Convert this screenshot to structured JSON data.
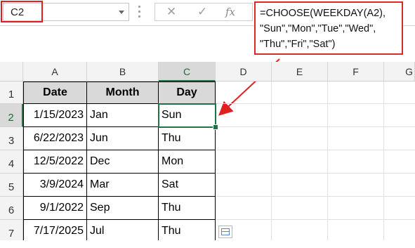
{
  "name_box": {
    "value": "C2"
  },
  "formula_bar": {
    "lines": [
      "=CHOOSE(WEEKDAY(A2),",
      "\"Sun\",\"Mon\",\"Tue\",\"Wed\",",
      "\"Thu\",\"Fri\",\"Sat\")"
    ]
  },
  "icons": {
    "cancel": "✕",
    "enter": "✓",
    "function": "fx"
  },
  "columns": [
    "A",
    "B",
    "C",
    "D",
    "E",
    "F",
    "G"
  ],
  "rows": [
    "1",
    "2",
    "3",
    "4",
    "5",
    "6",
    "7"
  ],
  "table": {
    "headers": [
      "Date",
      "Month",
      "Day"
    ],
    "rows": [
      [
        "1/15/2023",
        "Jan",
        "Sun"
      ],
      [
        "6/22/2023",
        "Jun",
        "Thu"
      ],
      [
        "12/5/2022",
        "Dec",
        "Mon"
      ],
      [
        "3/9/2024",
        "Mar",
        "Sat"
      ],
      [
        "9/1/2022",
        "Sep",
        "Thu"
      ],
      [
        "7/17/2025",
        "Jul",
        "Thu"
      ]
    ]
  },
  "selected_cell": "C2",
  "colors": {
    "accent": "#217346",
    "annotation": "#e02020",
    "header_fill": "#d9d9d9"
  }
}
